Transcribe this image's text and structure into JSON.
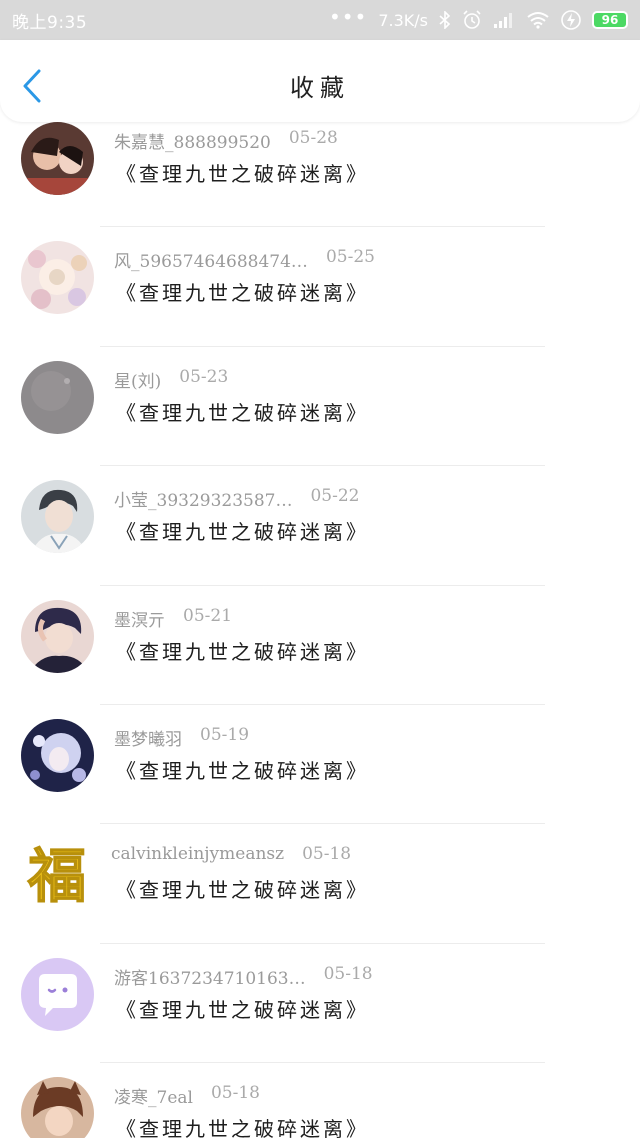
{
  "status_bar": {
    "time": "晚上9:35",
    "dots": "•••",
    "network_speed": "7.3K/s",
    "battery": "96",
    "icons": [
      "bluetooth-icon",
      "alarm-icon",
      "signal-icon",
      "wifi-icon",
      "charging-icon",
      "battery-icon"
    ]
  },
  "nav": {
    "title": "收藏",
    "back_icon": "chevron-left-icon"
  },
  "colors": {
    "accent": "#2b98e6",
    "status_bar_bg": "#d9d9d9",
    "battery": "#4cd964"
  },
  "items": [
    {
      "username": "朱嘉慧_888899520",
      "date": "05-28",
      "title": "《查理九世之破碎迷离》"
    },
    {
      "username": "风_59657464688474…",
      "date": "05-25",
      "title": "《查理九世之破碎迷离》"
    },
    {
      "username": "星(刘)",
      "date": "05-23",
      "title": "《查理九世之破碎迷离》"
    },
    {
      "username": "小莹_39329323587…",
      "date": "05-22",
      "title": "《查理九世之破碎迷离》"
    },
    {
      "username": "墨溟亓",
      "date": "05-21",
      "title": "《查理九世之破碎迷离》"
    },
    {
      "username": "墨梦曦羽",
      "date": "05-19",
      "title": "《查理九世之破碎迷离》"
    },
    {
      "username": "calvinkleinjymeansz",
      "date": "05-18",
      "title": "《查理九世之破碎迷离》"
    },
    {
      "username": "游客1637234710163…",
      "date": "05-18",
      "title": "《查理九世之破碎迷离》"
    },
    {
      "username": "凌寒_7eal",
      "date": "05-18",
      "title": "《查理九世之破碎迷离》"
    }
  ]
}
